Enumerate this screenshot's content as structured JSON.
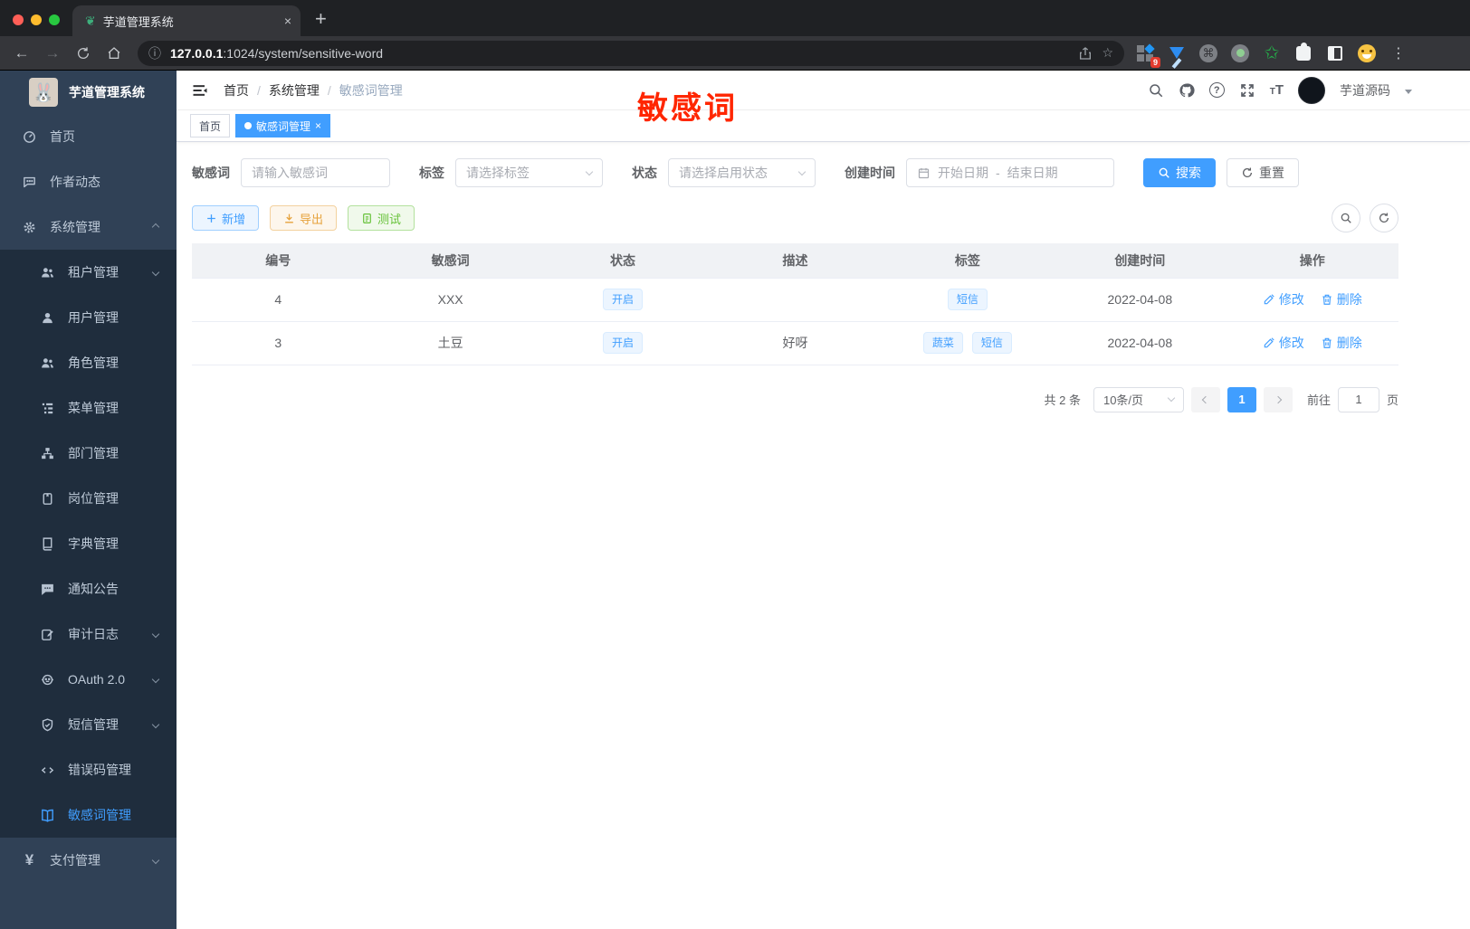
{
  "browser": {
    "tab_title": "芋道管理系统",
    "new_tab_label": "+",
    "close_tab_label": "×",
    "url_host": "127.0.0.1",
    "url_rest": ":1024/system/sensitive-word",
    "extension_badge": "9"
  },
  "annotation": {
    "text": "敏感词",
    "color": "#ff2600"
  },
  "sidebar": {
    "logo_title": "芋道管理系统",
    "top": [
      {
        "label": "首页"
      },
      {
        "label": "作者动态"
      },
      {
        "label": "系统管理"
      }
    ],
    "sub": [
      {
        "label": "租户管理"
      },
      {
        "label": "用户管理"
      },
      {
        "label": "角色管理"
      },
      {
        "label": "菜单管理"
      },
      {
        "label": "部门管理"
      },
      {
        "label": "岗位管理"
      },
      {
        "label": "字典管理"
      },
      {
        "label": "通知公告"
      },
      {
        "label": "审计日志"
      },
      {
        "label": "OAuth 2.0"
      },
      {
        "label": "短信管理"
      },
      {
        "label": "错误码管理"
      },
      {
        "label": "敏感词管理"
      }
    ],
    "bottom": [
      {
        "label": "支付管理"
      }
    ]
  },
  "header": {
    "breadcrumb": [
      "首页",
      "系统管理",
      "敏感词管理"
    ],
    "breadcrumb_separator": "/",
    "username": "芋道源码"
  },
  "tags_view": {
    "tabs": [
      {
        "label": "首页"
      },
      {
        "label": "敏感词管理"
      }
    ],
    "close_label": "×"
  },
  "filters": {
    "keyword_label": "敏感词",
    "keyword_placeholder": "请输入敏感词",
    "tag_label": "标签",
    "tag_placeholder": "请选择标签",
    "status_label": "状态",
    "status_placeholder": "请选择启用状态",
    "date_label": "创建时间",
    "date_start_placeholder": "开始日期",
    "date_separator": "-",
    "date_end_placeholder": "结束日期",
    "search_label": "搜索",
    "reset_label": "重置"
  },
  "toolbar": {
    "add_label": "新增",
    "export_label": "导出",
    "test_label": "测试"
  },
  "table": {
    "columns": [
      "编号",
      "敏感词",
      "状态",
      "描述",
      "标签",
      "创建时间",
      "操作"
    ],
    "edit_label": "修改",
    "delete_label": "删除",
    "rows": [
      {
        "id": "4",
        "word": "XXX",
        "status": "开启",
        "description": "",
        "tags": [
          "短信"
        ],
        "create_time": "2022-04-08"
      },
      {
        "id": "3",
        "word": "土豆",
        "status": "开启",
        "description": "好呀",
        "tags": [
          "蔬菜",
          "短信"
        ],
        "create_time": "2022-04-08"
      }
    ]
  },
  "pagination": {
    "total_text": "共 2 条",
    "page_size": "10条/页",
    "current_page": "1",
    "goto_label": "前往",
    "goto_value": "1",
    "page_unit": "页"
  },
  "colors": {
    "accent": "#409eff",
    "sidebar_bg": "#304156",
    "submenu_bg": "#1f2d3d",
    "annotation_red": "#ff2600",
    "tag_blue_bg": "#ecf5ff"
  }
}
